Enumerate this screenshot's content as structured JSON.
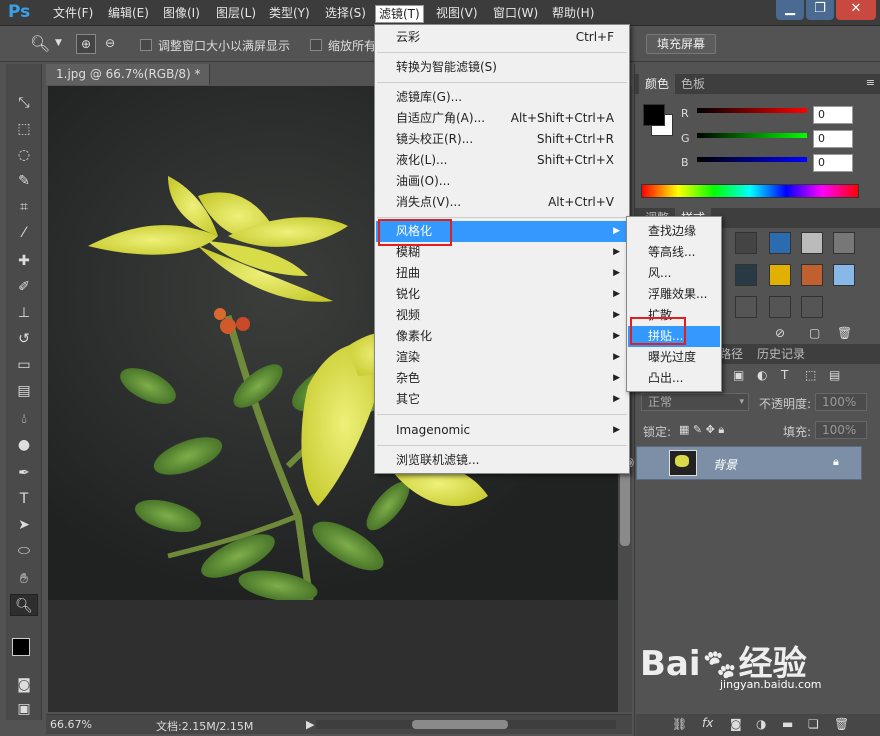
{
  "app": {
    "logo": "Ps"
  },
  "menubar": {
    "items": [
      "文件(F)",
      "编辑(E)",
      "图像(I)",
      "图层(L)",
      "类型(Y)",
      "选择(S)",
      "滤镜(T)",
      "视图(V)",
      "窗口(W)",
      "帮助(H)"
    ]
  },
  "options": {
    "check1_label": "调整窗口大小以满屏显示",
    "check2_label": "缩放所有",
    "fill_screen": "填充屏幕"
  },
  "document": {
    "tab_title": "1.jpg @ 66.7%(RGB/8) *",
    "zoom": "66.67%",
    "status": "文档:2.15M/2.15M"
  },
  "filter_menu": {
    "last_filter": "云彩",
    "last_filter_shortcut": "Ctrl+F",
    "smart": "转换为智能滤镜(S)",
    "items": [
      {
        "label": "滤镜库(G)...",
        "shortcut": ""
      },
      {
        "label": "自适应广角(A)...",
        "shortcut": "Alt+Shift+Ctrl+A"
      },
      {
        "label": "镜头校正(R)...",
        "shortcut": "Shift+Ctrl+R"
      },
      {
        "label": "液化(L)...",
        "shortcut": "Shift+Ctrl+X"
      },
      {
        "label": "油画(O)...",
        "shortcut": ""
      },
      {
        "label": "消失点(V)...",
        "shortcut": "Alt+Ctrl+V"
      }
    ],
    "groups": [
      "风格化",
      "模糊",
      "扭曲",
      "锐化",
      "视频",
      "像素化",
      "渲染",
      "杂色",
      "其它"
    ],
    "imagenomic": "Imagenomic",
    "browse": "浏览联机滤镜..."
  },
  "stylize_submenu": {
    "items": [
      "查找边缘",
      "等高线...",
      "风...",
      "浮雕效果...",
      "扩散",
      "拼贴...",
      "曝光过度",
      "凸出..."
    ],
    "highlighted": "拼贴..."
  },
  "color_panel": {
    "tabs": [
      "颜色",
      "色板"
    ],
    "r_label": "R",
    "g_label": "G",
    "b_label": "B",
    "r": "0",
    "g": "0",
    "b": "0"
  },
  "styles_panel": {
    "tabs": [
      "调整",
      "样式"
    ]
  },
  "layers_panel": {
    "tabs": [
      "路径",
      "历史记录"
    ],
    "blend_mode": "正常",
    "opacity_label": "不透明度:",
    "opacity": "100%",
    "lock_label": "锁定:",
    "fill_label": "填充:",
    "fill": "100%",
    "layer_name": "背景"
  },
  "watermark": {
    "brand": "Bai",
    "brand2": "经验",
    "url": "jingyan.baidu.com"
  },
  "colors": {
    "accent": "#3399ff",
    "highlight_box": "#e02020",
    "menubar": "#3c3c3c",
    "panel": "#535353"
  }
}
